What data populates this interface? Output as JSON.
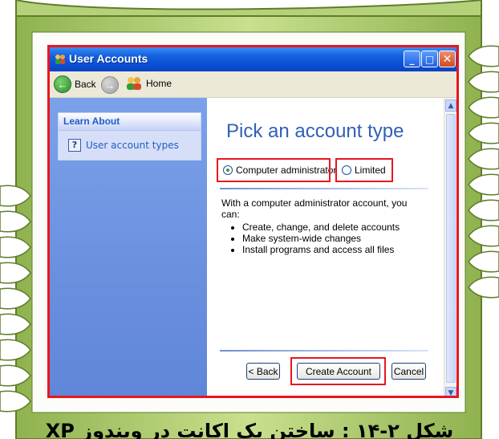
{
  "window": {
    "title": "User Accounts",
    "controls": {
      "minimize": "_",
      "maximize": "□",
      "close": "✕"
    }
  },
  "nav": {
    "back_label": "Back",
    "home_label": "Home"
  },
  "sidebar": {
    "learn_title": "Learn About",
    "help_icon": "?",
    "help_link": "User account types"
  },
  "main": {
    "heading": "Pick an account type",
    "options": [
      {
        "label": "Computer administrator",
        "selected": true
      },
      {
        "label": "Limited",
        "selected": false
      }
    ],
    "description_intro": "With a computer administrator account, you can:",
    "bullets": [
      "Create, change, and delete accounts",
      "Make system-wide changes",
      "Install programs and access all files"
    ],
    "buttons": {
      "back": "< Back",
      "create": "Create Account",
      "cancel": "Cancel"
    }
  },
  "caption": "شکل ۲-۱۴ : ساختن یک اکانت در ویندوز XP",
  "colors": {
    "highlight": "#e8171f",
    "title_blue": "#0a4fd6",
    "sidebar_blue": "#6b8fdf",
    "heading_blue": "#3160b5",
    "frame_green": "#9cc061"
  }
}
